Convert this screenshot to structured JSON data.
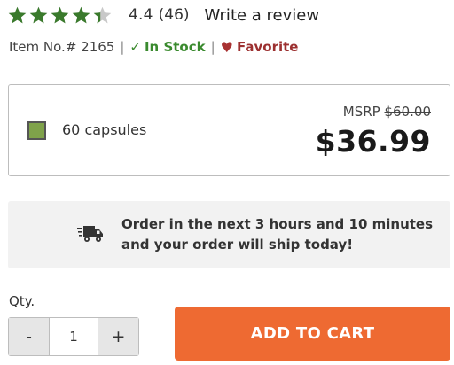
{
  "rating": {
    "value": "4.4",
    "stars_filled": 4.4,
    "star_color": "#3a7a2c",
    "star_empty_color": "#c8c8c8",
    "review_count": "(46)",
    "write_review_label": "Write a review"
  },
  "meta": {
    "item_number": "Item No.# 2165",
    "separator": "|",
    "stock_check": "✓",
    "stock_status": "In Stock",
    "favorite_icon": "heart-icon",
    "favorite_label": "Favorite"
  },
  "variant": {
    "swatch_color": "#7fa24a",
    "label": "60 capsules",
    "msrp_prefix": "MSRP",
    "msrp_value": "$60.00",
    "price": "$36.99"
  },
  "shipping": {
    "icon": "fast-delivery-truck-icon",
    "line1": "Order in the next 3 hours and 10 minutes",
    "line2": "and your order will ship today!"
  },
  "purchase": {
    "qty_label": "Qty.",
    "minus_label": "-",
    "qty_value": "1",
    "plus_label": "+",
    "add_to_cart_label": "ADD TO CART",
    "button_color": "#ee6a32"
  }
}
